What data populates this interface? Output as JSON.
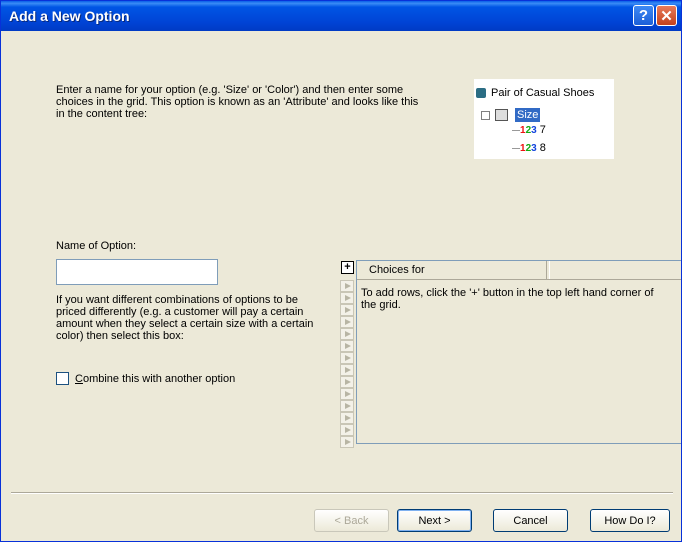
{
  "window": {
    "title": "Add a New Option",
    "help_glyph": "?",
    "close_glyph": "✕"
  },
  "intro_text": "Enter a name for your option (e.g. 'Size' or 'Color') and then enter some choices in the grid. This option is known as an 'Attribute' and looks like this in the content tree:",
  "tree": {
    "root_label": "Pair of Casual Shoes",
    "attribute_label": "Size",
    "expander_glyph": "⊟",
    "children": [
      {
        "number_icon": "123",
        "label": "7"
      },
      {
        "number_icon": "123",
        "label": "8"
      }
    ],
    "icons": [
      "package-icon",
      "grid-table-icon",
      "number-123-icon"
    ]
  },
  "name_field": {
    "label": "Name of Option:",
    "value": ""
  },
  "combine": {
    "description": "If you want different combinations of options to be priced differently (e.g. a customer will pay a certain amount when they select a certain size with a certain color) then select this box:",
    "checkbox_label": "Combine this with another option",
    "checked": false
  },
  "grid": {
    "add_button_glyph": "+",
    "column_header": "Choices for",
    "hint": "To add rows, click the '+' button in the top left hand corner of the grid."
  },
  "buttons": {
    "back": "< Back",
    "next": "Next >",
    "cancel": "Cancel",
    "how_do_i": "How Do I?"
  },
  "colors": {
    "title_bar": "#0055e5",
    "selection": "#316ac5",
    "dialog_background": "#ece9d8"
  }
}
